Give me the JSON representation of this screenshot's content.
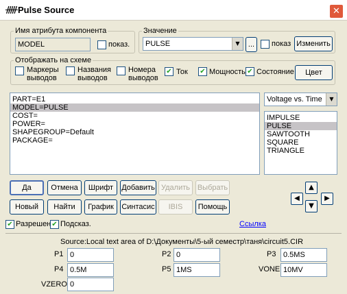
{
  "window": {
    "title": "Pulse Source",
    "close_glyph": "✕",
    "title_icon": "ᚏ"
  },
  "attr": {
    "group_label": "Имя атрибута компонента",
    "name_value": "MODEL",
    "show_label": "показ."
  },
  "value": {
    "group_label": "Значение",
    "selected": "PULSE",
    "browse_label": "...",
    "show_label": "показ",
    "change_label": "Изменить"
  },
  "display": {
    "group_label": "Отображать на схеме",
    "pin_markers": "Маркеры выводов",
    "pin_names": "Названия выводов",
    "pin_numbers": "Номера выводов",
    "current": "Ток",
    "power": "Мощность",
    "state": "Состояние",
    "color_button": "Цвет"
  },
  "attributes_list": [
    "PART=E1",
    "MODEL=PULSE",
    "COST=",
    "POWER=",
    "SHAPEGROUP=Default",
    "PACKAGE="
  ],
  "plot_select": "Voltage vs. Time",
  "waveforms": [
    "IMPULSE",
    "PULSE",
    "SAWTOOTH",
    "SQUARE",
    "TRIANGLE"
  ],
  "buttons": {
    "ok": "Да",
    "cancel": "Отмена",
    "font": "Шрифт",
    "add": "Добавить",
    "delete": "Удалить",
    "select": "Выбрать",
    "new": "Новый",
    "find": "Найти",
    "plot": "График",
    "syntax": "Синтасис",
    "ibis": "IBIS",
    "help": "Помощь"
  },
  "arrows": {
    "up": "▲",
    "down": "▼",
    "left": "◀",
    "right": "▶"
  },
  "options": {
    "enabled": "Разрешен",
    "hints": "Подсказ.",
    "link": "Ссылка"
  },
  "check_glyph": "✔",
  "source_text": "Source:Local text area of D:\\Документы\\5-ый семестр\\таня\\circuit5.CIR",
  "params": {
    "p1_label": "P1",
    "p1_value": "0",
    "p2_label": "P2",
    "p2_value": "0",
    "p3_label": "P3",
    "p3_value": "0.5MS",
    "p4_label": "P4",
    "p4_value": "0.5M",
    "p5_label": "P5",
    "p5_value": "1MS",
    "vone_label": "VONE",
    "vone_value": "10MV",
    "vzero_label": "VZERO",
    "vzero_value": "0"
  }
}
